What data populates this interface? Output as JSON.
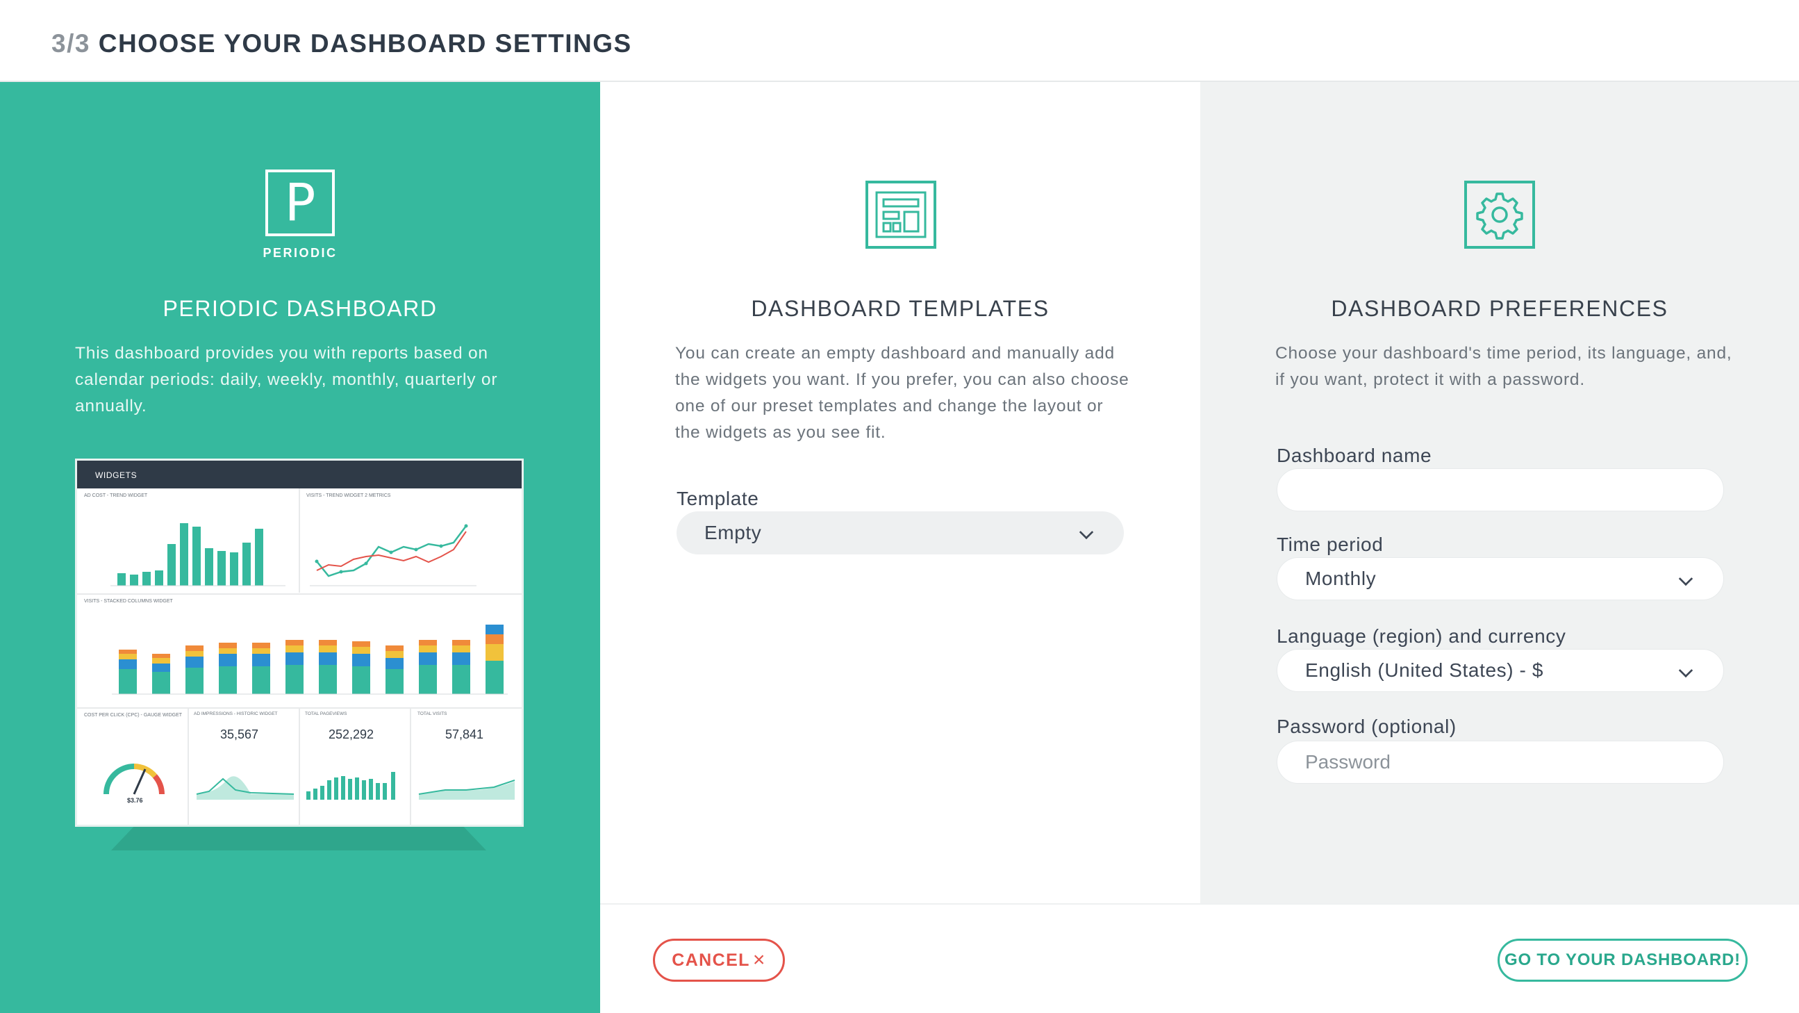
{
  "header": {
    "step": "3/3",
    "title": "CHOOSE YOUR DASHBOARD SETTINGS"
  },
  "left": {
    "logo_letter": "P",
    "logo_caption": "PERIODIC",
    "title": "PERIODIC DASHBOARD",
    "description": "This dashboard provides you with reports based on calendar periods: daily, weekly, monthly, quarterly or annually.",
    "preview": {
      "header": "WIDGETS",
      "widget1_title": "AD COST - TREND WIDGET",
      "widget2_title": "VISITS - TREND WIDGET 2 METRICS",
      "widget3_title": "VISITS - STACKED COLUMNS WIDGET",
      "gauge_title": "COST PER CLICK (CPC) - GAUGE WIDGET",
      "gauge_value": "$3.76",
      "kpi1_title": "AD IMPRESSIONS - HISTORIC WIDGET",
      "kpi1_value": "35,567",
      "kpi2_title": "TOTAL PAGEVIEWS",
      "kpi2_value": "252,292",
      "kpi3_title": "TOTAL VISITS",
      "kpi3_value": "57,841"
    }
  },
  "middle": {
    "title": "DASHBOARD TEMPLATES",
    "description": "You can create an empty dashboard and manually add the widgets you want. If you prefer, you can also choose one of our preset templates and change the layout or the widgets as you see fit.",
    "template_label": "Template",
    "template_value": "Empty"
  },
  "right": {
    "title": "DASHBOARD PREFERENCES",
    "description": "Choose your dashboard's time period, its language, and, if you want, protect it with a password.",
    "name_label": "Dashboard name",
    "name_value": "",
    "period_label": "Time period",
    "period_value": "Monthly",
    "language_label": "Language (region) and currency",
    "language_value": "English (United States) - $",
    "password_label": "Password (optional)",
    "password_placeholder": "Password"
  },
  "footer": {
    "cancel_label": "CANCEL",
    "cancel_icon": "×",
    "go_label": "GO TO YOUR DASHBOARD!"
  },
  "colors": {
    "accent": "#36b99e",
    "danger": "#e4534a",
    "dark": "#2f3a47"
  }
}
